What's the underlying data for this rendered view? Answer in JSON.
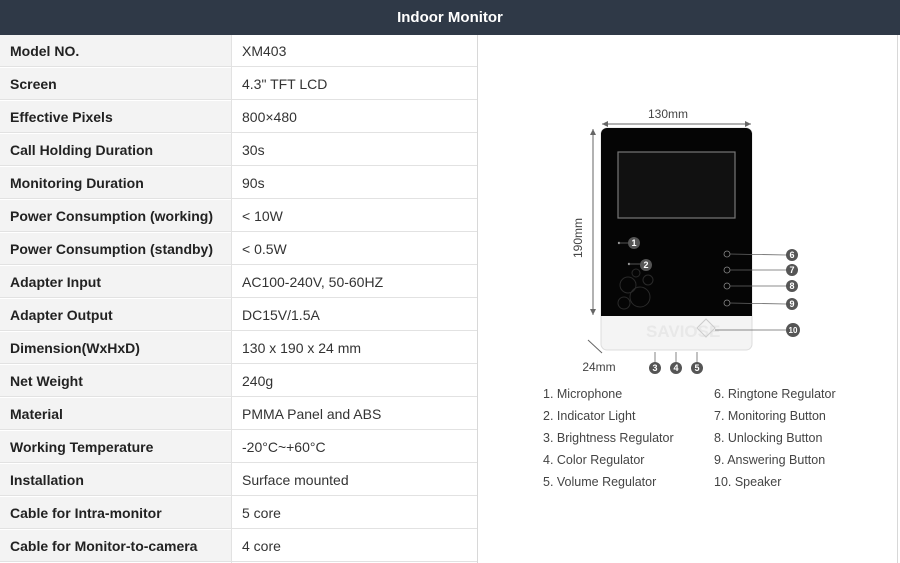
{
  "header": {
    "title": "Indoor Monitor"
  },
  "specs": [
    {
      "label": "Model NO.",
      "value": "XM403"
    },
    {
      "label": "Screen",
      "value": "4.3\" TFT LCD"
    },
    {
      "label": "Effective Pixels",
      "value": "800×480"
    },
    {
      "label": "Call Holding Duration",
      "value": "30s"
    },
    {
      "label": "Monitoring Duration",
      "value": "90s"
    },
    {
      "label": "Power Consumption (working)",
      "value": "< 10W"
    },
    {
      "label": "Power Consumption (standby)",
      "value": "< 0.5W"
    },
    {
      "label": "Adapter Input",
      "value": "AC100-240V, 50-60HZ"
    },
    {
      "label": "Adapter Output",
      "value": "DC15V/1.5A"
    },
    {
      "label": "Dimension(WxHxD)",
      "value": "130 x 190 x 24 mm"
    },
    {
      "label": "Net Weight",
      "value": "240g"
    },
    {
      "label": "Material",
      "value": "PMMA Panel and ABS"
    },
    {
      "label": "Working Temperature",
      "value": "-20°C~+60°C"
    },
    {
      "label": "Installation",
      "value": "Surface mounted"
    },
    {
      "label": "Cable for Intra-monitor",
      "value": "5 core"
    },
    {
      "label": "Cable for Monitor-to-camera",
      "value": "4 core"
    }
  ],
  "diagram": {
    "width_label": "130mm",
    "height_label": "190mm",
    "depth_label": "24mm",
    "brand_watermark": "SAVIOSE",
    "callouts": [
      "1",
      "2",
      "3",
      "4",
      "5",
      "6",
      "7",
      "8",
      "9",
      "10"
    ],
    "legend_left": [
      "1. Microphone",
      "2. Indicator Light",
      "3. Brightness Regulator",
      "4. Color Regulator",
      "5. Volume Regulator"
    ],
    "legend_right": [
      "6. Ringtone Regulator",
      "7. Monitoring Button",
      "8. Unlocking Button",
      "9. Answering Button",
      "10. Speaker"
    ]
  }
}
